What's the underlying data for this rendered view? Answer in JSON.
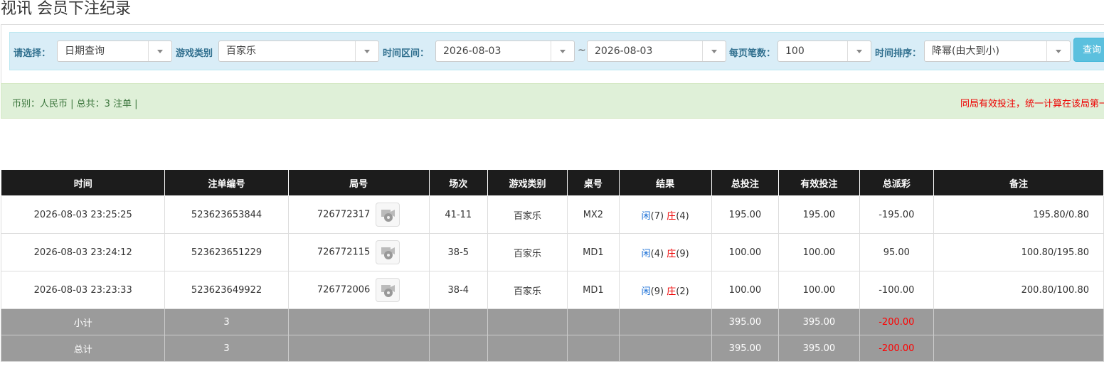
{
  "page_title": "视讯 会员下注纪录",
  "filters": {
    "select_label": "请选择：",
    "select_value": "日期查询",
    "game_type_label": "游戏类别",
    "game_type_value": "百家乐",
    "time_range_label": "时间区间：",
    "date_from": "2026-08-03",
    "tilde": "~",
    "date_to": "2026-08-03",
    "per_page_label": "每页笔数：",
    "per_page_value": "100",
    "sort_label": "时间排序：",
    "sort_value": "降幂(由大到小)",
    "query_button": "查询"
  },
  "info": {
    "summary": "币别：人民币 | 总共：3 注单 |",
    "notice": "同局有效投注，统一计算在该局第一笔注单"
  },
  "table": {
    "headers": [
      "时间",
      "注单编号",
      "局号",
      "场次",
      "游戏类别",
      "桌号",
      "结果",
      "总投注",
      "有效投注",
      "总派彩",
      "备注"
    ],
    "rows": [
      {
        "time": "2026-08-03 23:25:25",
        "order": "523623653844",
        "round": "726772317",
        "session": "41-11",
        "game": "百家乐",
        "table": "MX2",
        "player": "闲",
        "player_n": "(7)",
        "banker": "庄",
        "banker_n": "(4)",
        "bet": "195.00",
        "valid": "195.00",
        "payout": "-195.00",
        "payout_neg": true,
        "note": "195.80/0.80"
      },
      {
        "time": "2026-08-03 23:24:12",
        "order": "523623651229",
        "round": "726772115",
        "session": "38-5",
        "game": "百家乐",
        "table": "MD1",
        "player": "闲",
        "player_n": "(4)",
        "banker": "庄",
        "banker_n": "(9)",
        "bet": "100.00",
        "valid": "100.00",
        "payout": "95.00",
        "payout_neg": false,
        "note": "100.80/195.80"
      },
      {
        "time": "2026-08-03 23:23:33",
        "order": "523623649922",
        "round": "726772006",
        "session": "38-4",
        "game": "百家乐",
        "table": "MD1",
        "player": "闲",
        "player_n": "(9)",
        "banker": "庄",
        "banker_n": "(2)",
        "bet": "100.00",
        "valid": "100.00",
        "payout": "-100.00",
        "payout_neg": true,
        "note": "200.80/100.80"
      }
    ],
    "subtotal": {
      "label": "小计",
      "count": "3",
      "bet": "395.00",
      "valid": "395.00",
      "payout": "-200.00"
    },
    "total": {
      "label": "总计",
      "count": "3",
      "bet": "395.00",
      "valid": "395.00",
      "payout": "-200.00"
    }
  },
  "icons": {
    "video": "video-replay-icon",
    "dropdown": "chevron-down-icon"
  },
  "colors": {
    "player": "#1a6fd6",
    "banker": "#e00000",
    "header_bg": "#1c1c1c",
    "sum_bg": "#9b9b9b",
    "filter_bg": "#d9edf7",
    "info_bg": "#dff0d8"
  }
}
